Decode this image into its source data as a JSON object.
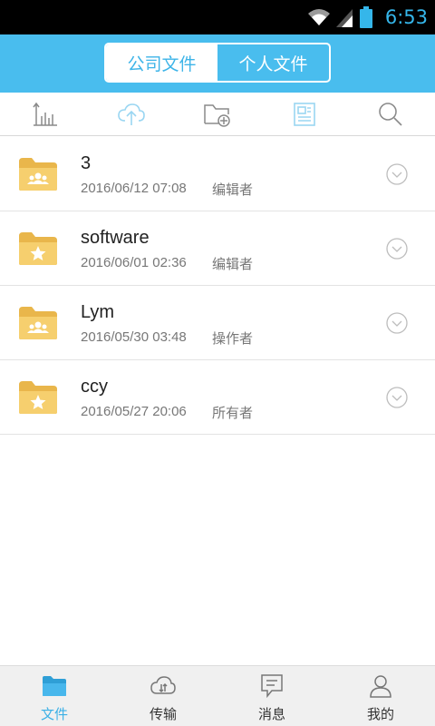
{
  "status_bar": {
    "time": "6:53",
    "icons": [
      "wifi-icon",
      "signal-icon",
      "battery-icon"
    ]
  },
  "header": {
    "tabs": [
      {
        "label": "公司文件",
        "active": true
      },
      {
        "label": "个人文件",
        "active": false
      }
    ],
    "accent_color": "#49bdee"
  },
  "toolbar": {
    "icons": [
      "sort-chart-icon",
      "upload-cloud-icon",
      "new-folder-icon",
      "document-icon",
      "search-icon"
    ]
  },
  "files": [
    {
      "name": "3",
      "date": "2016/06/12 07:08",
      "role": "编辑者",
      "folder_type": "shared-folder-icon"
    },
    {
      "name": "software",
      "date": "2016/06/01 02:36",
      "role": "编辑者",
      "folder_type": "starred-folder-icon"
    },
    {
      "name": "Lym",
      "date": "2016/05/30 03:48",
      "role": "操作者",
      "folder_type": "shared-folder-icon"
    },
    {
      "name": "ccy",
      "date": "2016/05/27 20:06",
      "role": "所有者",
      "folder_type": "starred-folder-icon"
    }
  ],
  "bottom_nav": [
    {
      "label": "文件",
      "icon": "folder-icon",
      "active": true
    },
    {
      "label": "传输",
      "icon": "transfer-icon",
      "active": false
    },
    {
      "label": "消息",
      "icon": "message-icon",
      "active": false
    },
    {
      "label": "我的",
      "icon": "profile-icon",
      "active": false
    }
  ]
}
